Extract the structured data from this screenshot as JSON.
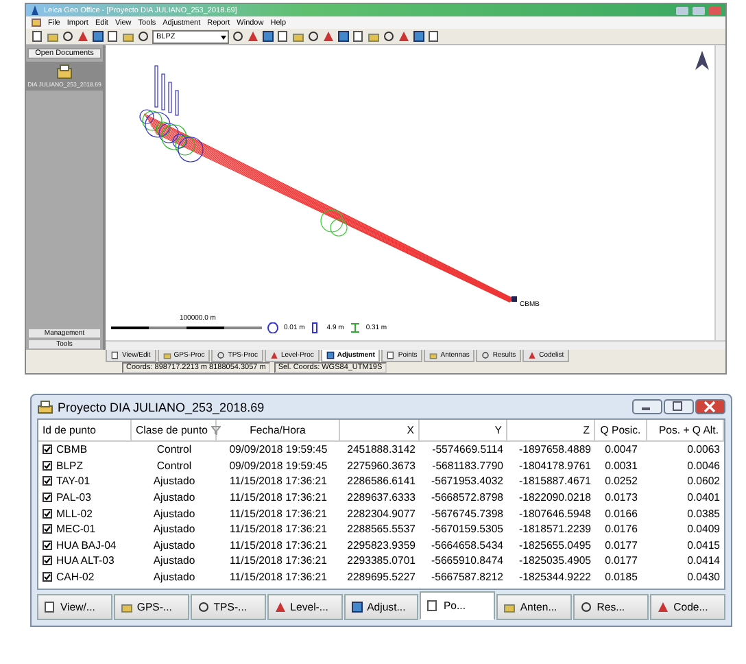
{
  "app_window": {
    "title": "Leica Geo Office - [Proyecto DIA JULIANO_253_2018.69]",
    "menu": [
      "File",
      "Import",
      "Edit",
      "View",
      "Tools",
      "Adjustment",
      "Report",
      "Window",
      "Help"
    ],
    "point_combo": "BLPZ",
    "sidebar": {
      "header": "Open Documents",
      "document": "DIA JULIANO_253_2018.69",
      "buttons": [
        "Management",
        "Tools"
      ]
    },
    "plot": {
      "end_label": "CBMB",
      "scale": "100000.0 m",
      "legend": [
        "0.01 m",
        "4.9 m",
        "0.31 m"
      ]
    },
    "tabs": [
      {
        "label": "View/Edit",
        "selected": false
      },
      {
        "label": "GPS-Proc",
        "selected": false
      },
      {
        "label": "TPS-Proc",
        "selected": false
      },
      {
        "label": "Level-Proc",
        "selected": false
      },
      {
        "label": "Adjustment",
        "selected": true
      },
      {
        "label": "Points",
        "selected": false
      },
      {
        "label": "Antennas",
        "selected": false
      },
      {
        "label": "Results",
        "selected": false
      },
      {
        "label": "Codelist",
        "selected": false
      }
    ],
    "status_bar": [
      "Coords: 898717.2213 m 8188054.3057 m",
      "Sel. Coords: WGS84_UTM19S"
    ]
  },
  "points_window": {
    "title": "Proyecto DIA JULIANO_253_2018.69",
    "table": {
      "columns": [
        "Id de punto",
        "Clase de punto",
        "Fecha/Hora",
        "X",
        "Y",
        "Z",
        "Q Posic.",
        "Pos. + Q Alt."
      ],
      "rows": [
        {
          "checked": true,
          "cells": [
            "CBMB",
            "Control",
            "09/09/2018 19:59:45",
            "2451888.3142",
            "-5574669.5114",
            "-1897658.4889",
            "0.0047",
            "0.0063"
          ]
        },
        {
          "checked": true,
          "cells": [
            "BLPZ",
            "Control",
            "09/09/2018 19:59:45",
            "2275960.3673",
            "-5681183.7790",
            "-1804178.9761",
            "0.0031",
            "0.0046"
          ]
        },
        {
          "checked": true,
          "cells": [
            "TAY-01",
            "Ajustado",
            "11/15/2018 17:36:21",
            "2286586.6141",
            "-5671953.4032",
            "-1815887.4671",
            "0.0252",
            "0.0602"
          ]
        },
        {
          "checked": true,
          "cells": [
            "PAL-03",
            "Ajustado",
            "11/15/2018 17:36:21",
            "2289637.6333",
            "-5668572.8798",
            "-1822090.0218",
            "0.0173",
            "0.0401"
          ]
        },
        {
          "checked": true,
          "cells": [
            "MLL-02",
            "Ajustado",
            "11/15/2018 17:36:21",
            "2282304.9077",
            "-5676745.7398",
            "-1807646.5948",
            "0.0166",
            "0.0385"
          ]
        },
        {
          "checked": true,
          "cells": [
            "MEC-01",
            "Ajustado",
            "11/15/2018 17:36:21",
            "2288565.5537",
            "-5670159.5305",
            "-1818571.2239",
            "0.0176",
            "0.0409"
          ]
        },
        {
          "checked": true,
          "cells": [
            "HUA BAJ-04",
            "Ajustado",
            "11/15/2018 17:36:21",
            "2295823.9359",
            "-5664658.5434",
            "-1825655.0495",
            "0.0177",
            "0.0415"
          ]
        },
        {
          "checked": true,
          "cells": [
            "HUA ALT-03",
            "Ajustado",
            "11/15/2018 17:36:21",
            "2293385.0701",
            "-5665910.8474",
            "-1825035.4905",
            "0.0177",
            "0.0414"
          ]
        },
        {
          "checked": true,
          "cells": [
            "CAH-02",
            "Ajustado",
            "11/15/2018 17:36:21",
            "2289695.5227",
            "-5667587.8212",
            "-1825344.9222",
            "0.0185",
            "0.0430"
          ]
        }
      ]
    },
    "tabs": [
      {
        "label": "View/...",
        "selected": false
      },
      {
        "label": "GPS-...",
        "selected": false
      },
      {
        "label": "TPS-...",
        "selected": false
      },
      {
        "label": "Level-...",
        "selected": false
      },
      {
        "label": "Adjust...",
        "selected": false
      },
      {
        "label": "Po...",
        "selected": true
      },
      {
        "label": "Anten...",
        "selected": false
      },
      {
        "label": "Res...",
        "selected": false
      },
      {
        "label": "Code...",
        "selected": false
      }
    ]
  }
}
